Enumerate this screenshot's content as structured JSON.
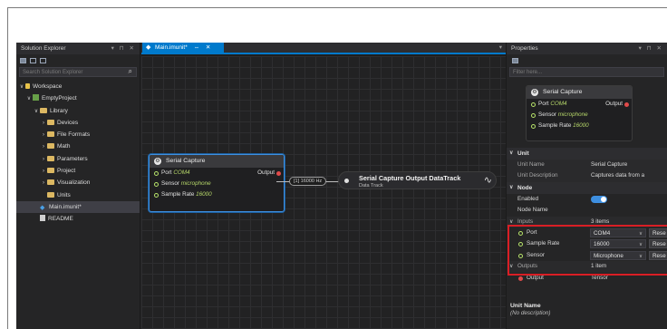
{
  "solution_explorer": {
    "title": "Solution Explorer",
    "controls": "▾ ⊓ ✕",
    "search_placeholder": "Search Solution Explorer",
    "items": [
      {
        "label": "Workspace"
      },
      {
        "label": "EmptyProject"
      },
      {
        "label": "Library"
      },
      {
        "label": "Devices"
      },
      {
        "label": "File Formats"
      },
      {
        "label": "Math"
      },
      {
        "label": "Parameters"
      },
      {
        "label": "Project"
      },
      {
        "label": "Visualization"
      },
      {
        "label": "Units"
      },
      {
        "label": "Main.imunit*"
      },
      {
        "label": "README"
      }
    ]
  },
  "editor": {
    "tab": {
      "label": "Main.imunit*",
      "pin": "⇔",
      "close": "✕"
    },
    "pane_ctl": "▾",
    "serial_node": {
      "title": "Serial Capture",
      "rows": [
        {
          "label": "Port",
          "value": "COM4",
          "output": "Output"
        },
        {
          "label": "Sensor",
          "value": "microphone"
        },
        {
          "label": "Sample Rate",
          "value": "16000"
        }
      ]
    },
    "wire_label": "[1] 16000 Hz",
    "datatrack_node": {
      "title": "Serial Capture Output DataTrack",
      "subtitle": "Data Track"
    }
  },
  "properties": {
    "title": "Properties",
    "controls": "▾ ⊓ ✕",
    "filter_placeholder": "Filter here...",
    "preview": {
      "title": "Serial Capture",
      "rows": [
        {
          "label": "Port",
          "value": "COM4",
          "output": "Output"
        },
        {
          "label": "Sensor",
          "value": "microphone"
        },
        {
          "label": "Sample Rate",
          "value": "16000"
        }
      ]
    },
    "unit_section": "Unit",
    "unit_name_label": "Unit Name",
    "unit_name_value": "Serial Capture",
    "unit_desc_label": "Unit Description",
    "unit_desc_value": "Captures data from a",
    "node_section": "Node",
    "enabled_label": "Enabled",
    "enabled": true,
    "node_name_label": "Node Name",
    "inputs_label": "Inputs",
    "inputs_count": "3 items",
    "inputs": [
      {
        "label": "Port",
        "value": "COM4",
        "reset": "Rese"
      },
      {
        "label": "Sample Rate",
        "value": "16000",
        "reset": "Rese"
      },
      {
        "label": "Sensor",
        "value": "Microphone",
        "reset": "Rese"
      }
    ],
    "outputs_label": "Outputs",
    "outputs_count": "1 item",
    "output_label": "Output",
    "output_value": "Tensor",
    "footer_title": "Unit Name",
    "footer_desc": "(No description)"
  },
  "colors": {
    "accent": "#007acc",
    "highlight": "#d91e25",
    "pin_green": "#b7e36a",
    "pin_red": "#e04a4a"
  }
}
